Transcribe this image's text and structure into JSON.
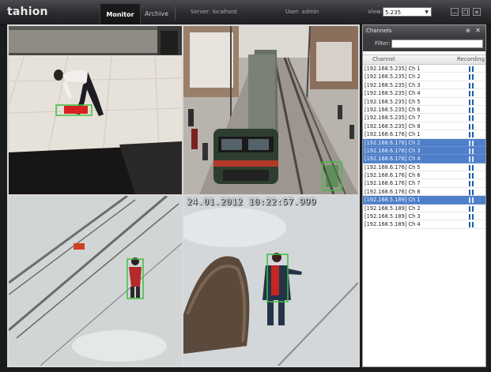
{
  "app": {
    "logo": "tahion"
  },
  "tabs": {
    "monitor": "Monitor",
    "archive": "Archive"
  },
  "header": {
    "server": "Server: localhost",
    "user": "User: admin",
    "view_label": "View:",
    "view_value": "5.235"
  },
  "window_controls": {
    "minimize": "—",
    "restore": "❐",
    "close": "✕"
  },
  "cameras": {
    "timestamp": "24.01.2012 10:22:57.999"
  },
  "channels_panel": {
    "title": "Channels",
    "pin_icon": "⊕",
    "close_icon": "✕",
    "filter_label": "Filter:",
    "filter_value": "",
    "col_channel": "Channel",
    "col_recording": "Recording",
    "rows": [
      {
        "label": "[192.168.5.235] Ch 1",
        "selected": false
      },
      {
        "label": "[192.168.5.235] Ch 2",
        "selected": false
      },
      {
        "label": "[192.168.5.235] Ch 3",
        "selected": false
      },
      {
        "label": "[192.168.5.235] Ch 4",
        "selected": false
      },
      {
        "label": "[192.168.5.235] Ch 5",
        "selected": false
      },
      {
        "label": "[192.168.5.235] Ch 6",
        "selected": false
      },
      {
        "label": "[192.168.5.235] Ch 7",
        "selected": false
      },
      {
        "label": "[192.168.5.235] Ch 8",
        "selected": false
      },
      {
        "label": "[192.168.6.176] Ch 1",
        "selected": false
      },
      {
        "label": "[192.168.6.176] Ch 2",
        "selected": true
      },
      {
        "label": "[192.168.6.176] Ch 3",
        "selected": true
      },
      {
        "label": "[192.168.6.176] Ch 4",
        "selected": true
      },
      {
        "label": "[192.168.6.176] Ch 5",
        "selected": false
      },
      {
        "label": "[192.168.6.176] Ch 6",
        "selected": false
      },
      {
        "label": "[192.168.6.176] Ch 7",
        "selected": false
      },
      {
        "label": "[192.168.6.176] Ch 8",
        "selected": false
      },
      {
        "label": "[192.168.5.189] Ch 1",
        "selected": true
      },
      {
        "label": "[192.168.5.189] Ch 2",
        "selected": false
      },
      {
        "label": "[192.168.5.189] Ch 3",
        "selected": false
      },
      {
        "label": "[192.168.5.189] Ch 4",
        "selected": false
      }
    ]
  },
  "colors": {
    "detection_box": "#3fbf3f",
    "motion_fill": "#d82020",
    "selection": "#4f7fc8",
    "recording_icon": "#1c5da8"
  },
  "icons": {
    "recording": "recording-bars-icon",
    "dropdown": "chevron-down-icon"
  }
}
